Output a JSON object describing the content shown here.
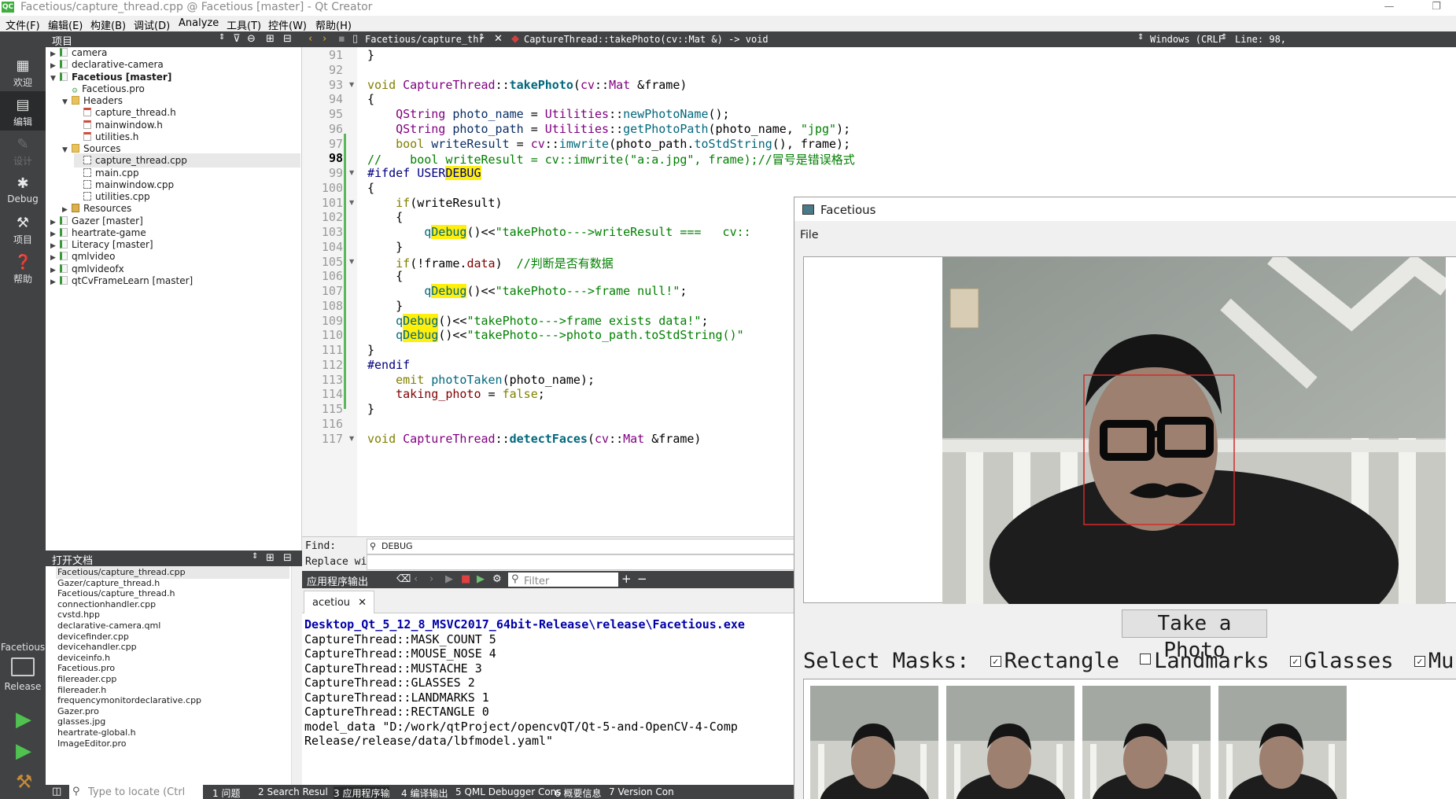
{
  "window": {
    "title": "Facetious/capture_thread.cpp @ Facetious [master] - Qt Creator",
    "app_icon": "QC",
    "minimize": "—",
    "restore": "❐"
  },
  "menu": [
    "文件(F)",
    "编辑(E)",
    "构建(B)",
    "调试(D)",
    "Analyze",
    "工具(T)",
    "控件(W)",
    "帮助(H)"
  ],
  "modes": [
    {
      "icon": "grid-icon",
      "label": "欢迎"
    },
    {
      "icon": "edit-icon",
      "label": "编辑"
    },
    {
      "icon": "design-icon",
      "label": "设计"
    },
    {
      "icon": "bug-icon",
      "label": "Debug"
    },
    {
      "icon": "wrench-icon",
      "label": "项目"
    },
    {
      "icon": "help-icon",
      "label": "帮助"
    }
  ],
  "kit": {
    "project": "Facetious",
    "config": "Release"
  },
  "projects_pane": {
    "title": "项目",
    "tree": [
      {
        "label": "camera",
        "icon": "proj",
        "arrow": "▶",
        "depth": 0
      },
      {
        "label": "declarative-camera",
        "icon": "proj",
        "arrow": "▶",
        "depth": 0
      },
      {
        "label": "Facetious [master]",
        "icon": "proj",
        "arrow": "▼",
        "depth": 0,
        "bold": true
      },
      {
        "label": "Facetious.pro",
        "icon": "pro",
        "arrow": "",
        "depth": 1
      },
      {
        "label": "Headers",
        "icon": "folder",
        "arrow": "▼",
        "depth": 1
      },
      {
        "label": "capture_thread.h",
        "icon": "hfile",
        "arrow": "",
        "depth": 2
      },
      {
        "label": "mainwindow.h",
        "icon": "hfile",
        "arrow": "",
        "depth": 2
      },
      {
        "label": "utilities.h",
        "icon": "hfile",
        "arrow": "",
        "depth": 2
      },
      {
        "label": "Sources",
        "icon": "folder",
        "arrow": "▼",
        "depth": 1
      },
      {
        "label": "capture_thread.cpp",
        "icon": "cpp",
        "arrow": "",
        "depth": 2,
        "selected": true
      },
      {
        "label": "main.cpp",
        "icon": "cpp",
        "arrow": "",
        "depth": 2
      },
      {
        "label": "mainwindow.cpp",
        "icon": "cpp",
        "arrow": "",
        "depth": 2
      },
      {
        "label": "utilities.cpp",
        "icon": "cpp",
        "arrow": "",
        "depth": 2
      },
      {
        "label": "Resources",
        "icon": "res",
        "arrow": "▶",
        "depth": 1
      },
      {
        "label": "Gazer [master]",
        "icon": "proj",
        "arrow": "▶",
        "depth": 0
      },
      {
        "label": "heartrate-game",
        "icon": "proj",
        "arrow": "▶",
        "depth": 0
      },
      {
        "label": "Literacy [master]",
        "icon": "proj",
        "arrow": "▶",
        "depth": 0
      },
      {
        "label": "qmlvideo",
        "icon": "proj",
        "arrow": "▶",
        "depth": 0
      },
      {
        "label": "qmlvideofx",
        "icon": "proj",
        "arrow": "▶",
        "depth": 0
      },
      {
        "label": "qtCvFrameLearn [master]",
        "icon": "proj",
        "arrow": "▶",
        "depth": 0
      }
    ]
  },
  "open_docs": {
    "title": "打开文档",
    "items": [
      "Facetious/capture_thread.cpp",
      "Gazer/capture_thread.h",
      "Facetious/capture_thread.h",
      "connectionhandler.cpp",
      "cvstd.hpp",
      "declarative-camera.qml",
      "devicefinder.cpp",
      "devicehandler.cpp",
      "deviceinfo.h",
      "Facetious.pro",
      "filereader.cpp",
      "filereader.h",
      "frequencymonitordeclarative.cpp",
      "Gazer.pro",
      "glasses.jpg",
      "heartrate-global.h",
      "ImageEditor.pro"
    ]
  },
  "editor_toolbar": {
    "file": "Facetious/capture_thr",
    "symbol": "CaptureThread::takePhoto(cv::Mat &) -> void",
    "line_ending": "Windows (CRLF",
    "position": "Line: 98,"
  },
  "code": {
    "current_line": 98,
    "lines": [
      {
        "n": "91",
        "fold": "",
        "html": "}"
      },
      {
        "n": "92",
        "fold": "",
        "html": ""
      },
      {
        "n": "93",
        "fold": "▼",
        "html": "<span class='kw'>void</span> <span class='ty'>CaptureThread</span>::<span class='fnb'>takePhoto</span>(<span class='ty'>cv</span>::<span class='ty'>Mat</span> &amp;frame)"
      },
      {
        "n": "94",
        "fold": "",
        "html": "{"
      },
      {
        "n": "95",
        "fold": "",
        "html": "    <span class='ty'>QString</span> <span class='va'>photo_name</span> = <span class='ty'>Utilities</span>::<span class='fn'>newPhotoName</span>();"
      },
      {
        "n": "96",
        "fold": "",
        "html": "    <span class='ty'>QString</span> <span class='va'>photo_path</span> = <span class='ty'>Utilities</span>::<span class='fn'>getPhotoPath</span>(photo_name, <span class='st'>\"jpg\"</span>);"
      },
      {
        "n": "97",
        "fold": "",
        "html": "    <span class='kw'>bool</span> <span class='va'>writeResult</span> = <span class='ty'>cv</span>::<span class='fn'>imwrite</span>(photo_path.<span class='fn'>toStdString</span>(), frame);"
      },
      {
        "n": "98",
        "fold": "",
        "html": "<span class='cm'>//    bool writeResult = cv::imwrite(\"a:a.jpg\", frame);//冒号是错误格式</span>"
      },
      {
        "n": "99",
        "fold": "▼",
        "html": "<span class='pp'>#ifdef USER<span class='hl'>DEBUG</span></span>"
      },
      {
        "n": "100",
        "fold": "",
        "html": "{"
      },
      {
        "n": "101",
        "fold": "▼",
        "html": "    <span class='kw'>if</span>(writeResult)"
      },
      {
        "n": "102",
        "fold": "",
        "html": "    {"
      },
      {
        "n": "103",
        "fold": "",
        "html": "        <span class='fn'>q<span class='hl'>Debug</span></span>()&lt;&lt;<span class='st'>\"takePhoto---&gt;writeResult ===   cv::</span>"
      },
      {
        "n": "104",
        "fold": "",
        "html": "    }"
      },
      {
        "n": "105",
        "fold": "▼",
        "html": "    <span class='kw'>if</span>(!frame.<span class='mb'>data</span>)  <span class='cm'>//判断是否有数据</span>"
      },
      {
        "n": "106",
        "fold": "",
        "html": "    {"
      },
      {
        "n": "107",
        "fold": "",
        "html": "        <span class='fn'>q<span class='hl'>Debug</span></span>()&lt;&lt;<span class='st'>\"takePhoto---&gt;frame null!\"</span>;"
      },
      {
        "n": "108",
        "fold": "",
        "html": "    }"
      },
      {
        "n": "109",
        "fold": "",
        "html": "    <span class='fn'>q<span class='hl'>Debug</span></span>()&lt;&lt;<span class='st'>\"takePhoto---&gt;frame exists data!\"</span>;"
      },
      {
        "n": "110",
        "fold": "",
        "html": "    <span class='fn'>q<span class='hl'>Debug</span></span>()&lt;&lt;<span class='st'>\"takePhoto---&gt;photo_path.toStdString()\"</span>"
      },
      {
        "n": "111",
        "fold": "",
        "html": "}"
      },
      {
        "n": "112",
        "fold": "",
        "html": "<span class='pp'>#endif</span>"
      },
      {
        "n": "113",
        "fold": "",
        "html": "    <span class='kw'>emit</span> <span class='fn'>photoTaken</span>(photo_name);"
      },
      {
        "n": "114",
        "fold": "",
        "html": "    <span class='mb'>taking_photo</span> = <span class='kw'>false</span>;"
      },
      {
        "n": "115",
        "fold": "",
        "html": "}"
      },
      {
        "n": "116",
        "fold": "",
        "html": ""
      },
      {
        "n": "117",
        "fold": "▼",
        "html": "<span class='kw'>void</span> <span class='ty'>CaptureThread</span>::<span class='fnb'>detectFaces</span>(<span class='ty'>cv</span>::<span class='ty'>Mat</span> &amp;frame)"
      }
    ]
  },
  "find": {
    "label": "Find:",
    "value": "DEBUG",
    "replace_label": "Replace wi"
  },
  "output": {
    "title": "应用程序输出",
    "filter_placeholder": "Filter",
    "tab": "acetiou",
    "lines": [
      "Desktop_Qt_5_12_8_MSVC2017_64bit-Release\\release\\Facetious.exe",
      "CaptureThread::MASK_COUNT 5",
      "CaptureThread::MOUSE_NOSE 4",
      "CaptureThread::MUSTACHE 3",
      "CaptureThread::GLASSES 2",
      "CaptureThread::LANDMARKS 1",
      "CaptureThread::RECTANGLE 0",
      "model_data \"D:/work/qtProject/opencvQT/Qt-5-and-OpenCV-4-Comp",
      "Release/release/data/lbfmodel.yaml\""
    ]
  },
  "statusbar": {
    "locate_placeholder": "Type to locate (Ctrl",
    "tabs": [
      "1 问题",
      "2 Search Resul",
      "3 应用程序输",
      "4 编译输出",
      "5 QML Debugger Cons",
      "6 概要信息",
      "7 Version Con"
    ]
  },
  "facetious": {
    "title": "Facetious",
    "menu": "File",
    "take_photo": "Take a Photo",
    "select_label": "Select Masks:",
    "masks": [
      {
        "label": "Rectangle",
        "checked": true
      },
      {
        "label": "Landmarks",
        "checked": false
      },
      {
        "label": "Glasses",
        "checked": true
      },
      {
        "label": "Mustache",
        "checked": true
      }
    ]
  }
}
